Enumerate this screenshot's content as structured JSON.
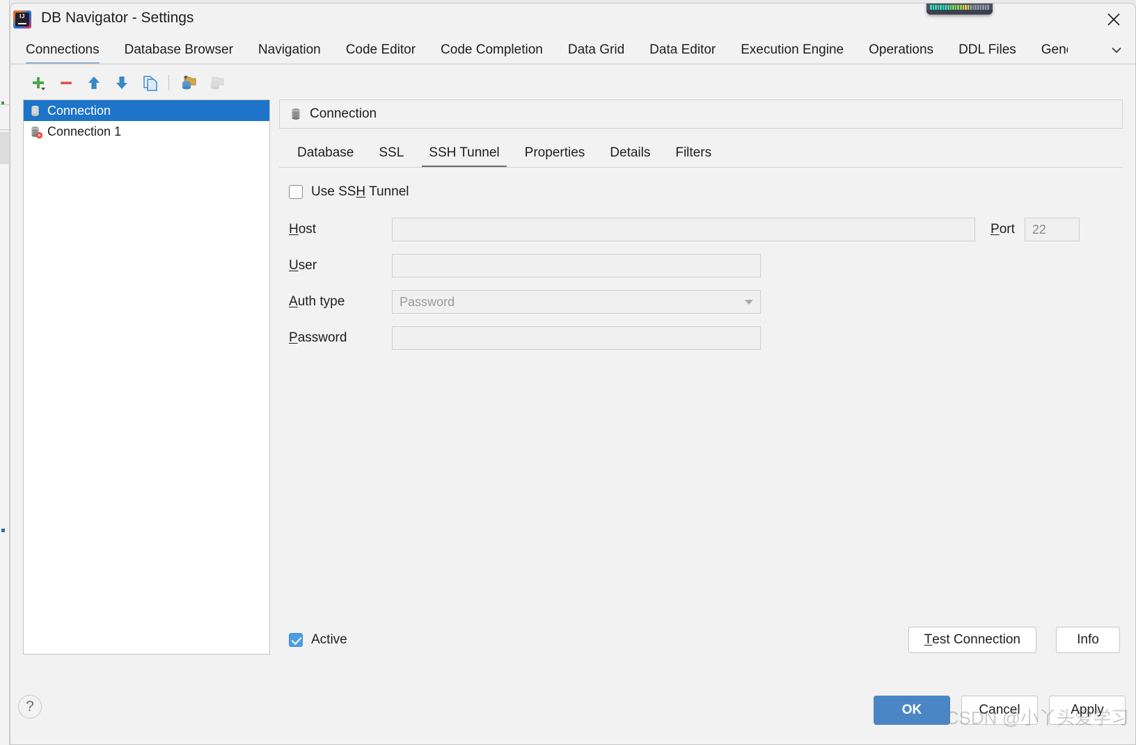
{
  "window": {
    "title": "DB Navigator - Settings",
    "app_icon": "intellij-idea-icon",
    "close_label": "✕"
  },
  "overlay_widget": {
    "name": "audio-level-meter-overlay",
    "bars_total": 24,
    "bars_lit": 16
  },
  "main_tabs": [
    {
      "label": "Connections",
      "active": true
    },
    {
      "label": "Database Browser",
      "active": false
    },
    {
      "label": "Navigation",
      "active": false
    },
    {
      "label": "Code Editor",
      "active": false
    },
    {
      "label": "Code Completion",
      "active": false
    },
    {
      "label": "Data Grid",
      "active": false
    },
    {
      "label": "Data Editor",
      "active": false
    },
    {
      "label": "Execution Engine",
      "active": false
    },
    {
      "label": "Operations",
      "active": false
    },
    {
      "label": "DDL Files",
      "active": false
    },
    {
      "label": "Gene",
      "active": false,
      "truncated": true
    }
  ],
  "tab_overflow_icon": "chevron-down-icon",
  "toolbar": [
    {
      "name": "add-connection-button",
      "icon": "plus-icon",
      "enabled": true
    },
    {
      "name": "remove-connection-button",
      "icon": "minus-icon",
      "enabled": true
    },
    {
      "name": "move-up-button",
      "icon": "arrow-up-icon",
      "enabled": true
    },
    {
      "name": "move-down-button",
      "icon": "arrow-down-icon",
      "enabled": true
    },
    {
      "name": "duplicate-connection-button",
      "icon": "copy-pages-icon",
      "enabled": true
    },
    {
      "name": "copy-connection-button",
      "icon": "export-database-icon",
      "enabled": true
    },
    {
      "name": "paste-connection-button",
      "icon": "import-database-icon",
      "enabled": false
    }
  ],
  "connection_list": [
    {
      "label": "Connection",
      "icon": "database-icon",
      "selected": true
    },
    {
      "label": "Connection 1",
      "icon": "database-error-icon",
      "selected": false
    }
  ],
  "panel": {
    "header": {
      "title": "Connection",
      "icon": "database-icon"
    },
    "sub_tabs": [
      {
        "label": "Database",
        "active": false
      },
      {
        "label": "SSL",
        "active": false
      },
      {
        "label": "SSH Tunnel",
        "active": true
      },
      {
        "label": "Properties",
        "active": false
      },
      {
        "label": "Details",
        "active": false
      },
      {
        "label": "Filters",
        "active": false
      }
    ],
    "form": {
      "use_ssh_tunnel": {
        "label_a": "Use SS",
        "mnemonic": "H",
        "label_b": " Tunnel",
        "checked": false
      },
      "host": {
        "mnemonic": "H",
        "label_rest": "ost",
        "value": "",
        "placeholder": ""
      },
      "port": {
        "mnemonic": "P",
        "label_rest": "ort",
        "value": "22"
      },
      "user": {
        "mnemonic": "U",
        "label_rest": "ser",
        "value": "",
        "placeholder": ""
      },
      "auth_type": {
        "mnemonic": "A",
        "label_rest": "uth type",
        "value": "Password",
        "options": "Password"
      },
      "password": {
        "mnemonic": "P",
        "label_rest": "assword",
        "value": "",
        "placeholder": ""
      }
    },
    "active_checkbox": {
      "label": "Active",
      "checked": true
    },
    "test_connection_button": {
      "mnemonic": "T",
      "label_rest": "est Connection"
    },
    "info_button": {
      "label": "Info"
    }
  },
  "footer": {
    "help_label": "?",
    "ok_label": "OK",
    "cancel_label": "Cancel",
    "apply_label": "Apply"
  },
  "watermark": "CSDN @小丫头爱学习",
  "colors": {
    "accent_blue": "#3d7ab5",
    "selection_blue": "#1d74c8",
    "primary_button": "#4a86c5",
    "checkbox_blue": "#4d9ee0",
    "panel_bg": "#f2f2f2"
  }
}
